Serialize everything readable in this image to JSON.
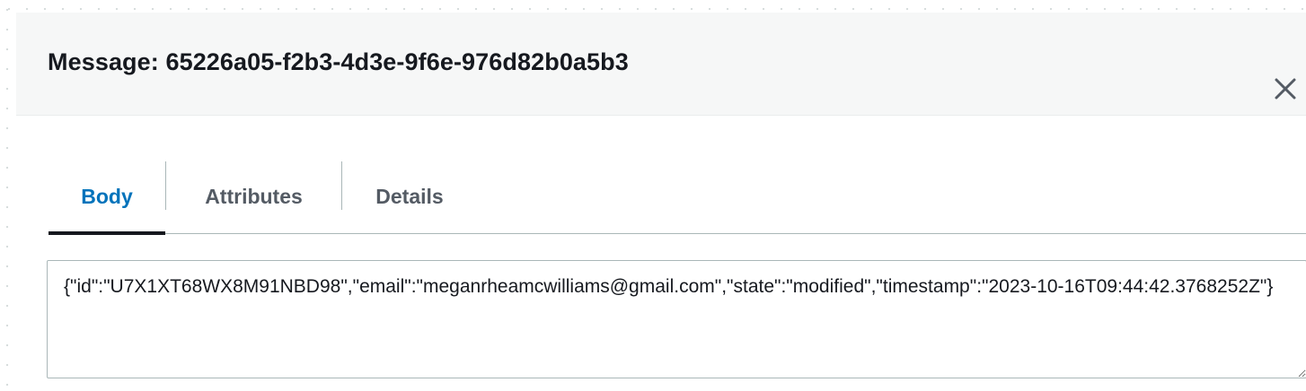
{
  "modal": {
    "title": "Message: 65226a05-f2b3-4d3e-9f6e-976d82b0a5b3",
    "close_icon": "close-icon"
  },
  "tabs": [
    {
      "label": "Body",
      "active": true
    },
    {
      "label": "Attributes",
      "active": false
    },
    {
      "label": "Details",
      "active": false
    }
  ],
  "body": {
    "value": "{\"id\":\"U7X1XT68WX8M91NBD98\",\"email\":\"meganrheamcwilliams@gmail.com\",\"state\":\"modified\",\"timestamp\":\"2023-10-16T09:44:42.3768252Z\"}"
  },
  "colors": {
    "active_tab": "#0073bb",
    "inactive_tab": "#545b64",
    "header_background": "#f6f7f7",
    "text": "#16191f"
  }
}
